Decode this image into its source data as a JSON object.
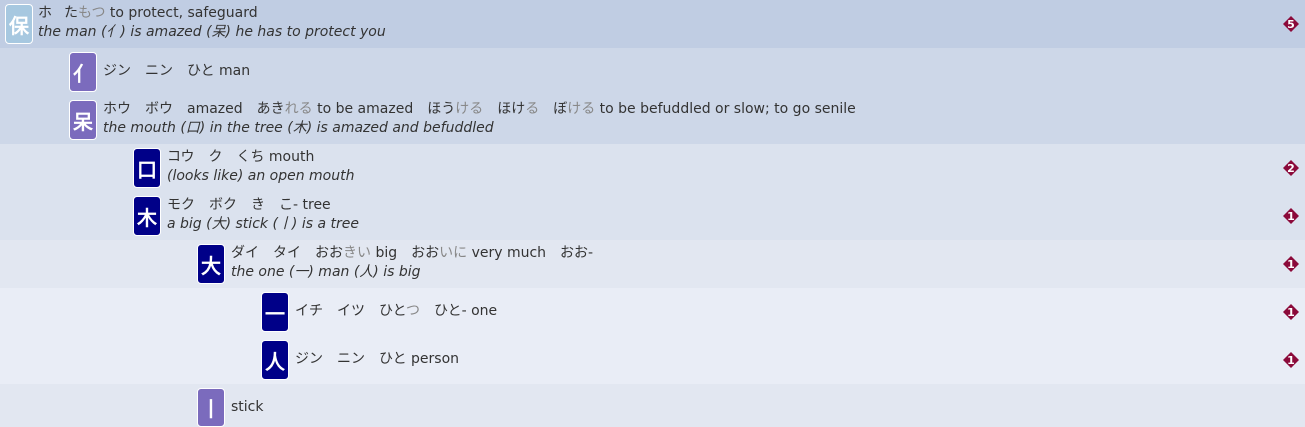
{
  "rows": [
    {
      "kanji": "保",
      "readings": [
        {
          "main": "ホ",
          "okuri": ""
        },
        {
          "main": "た",
          "okuri": "もつ"
        }
      ],
      "meaning": "to protect, safeguard",
      "mnemonic": "the man (亻) is amazed (呆) he has to protect you",
      "badge": "5"
    },
    {
      "kanji": "亻",
      "line1": "ジン　ニン　ひと man"
    },
    {
      "kanji": "呆",
      "line1_parts": [
        "ホウ　ボウ　amazed　あき",
        "れる",
        " to be amazed　ほう",
        "ける",
        "　ほけ",
        "る",
        "　ぼ",
        "ける",
        " to be befuddled or slow; to go senile"
      ],
      "mnemonic": "the mouth (口) in the tree (木) is amazed and befuddled"
    },
    {
      "kanji": "口",
      "line1": "コウ　ク　くち mouth",
      "mnemonic": "(looks like) an open mouth",
      "badge": "2"
    },
    {
      "kanji": "木",
      "line1": "モク　ボク　き　こ- tree",
      "mnemonic": "a big (大) stick (丨) is a tree",
      "badge": "1"
    },
    {
      "kanji": "大",
      "line1_parts": [
        "ダイ　タイ　おお",
        "きい",
        " big　おお",
        "いに",
        " very much　おお-"
      ],
      "mnemonic": "the one (一) man (人) is big",
      "badge": "1"
    },
    {
      "kanji": "一",
      "line1_parts": [
        "イチ　イツ　ひと",
        "つ",
        "　ひと- one"
      ],
      "badge": "1"
    },
    {
      "kanji": "人",
      "line1": "ジン　ニン　ひと person",
      "badge": "1"
    },
    {
      "kanji": "丨",
      "line1": "stick"
    }
  ],
  "colors": {
    "badge": "#8b0a3a",
    "tile_light": "#a7c8e0",
    "tile_purple": "#7b6bbd",
    "tile_navy": "#000088"
  }
}
